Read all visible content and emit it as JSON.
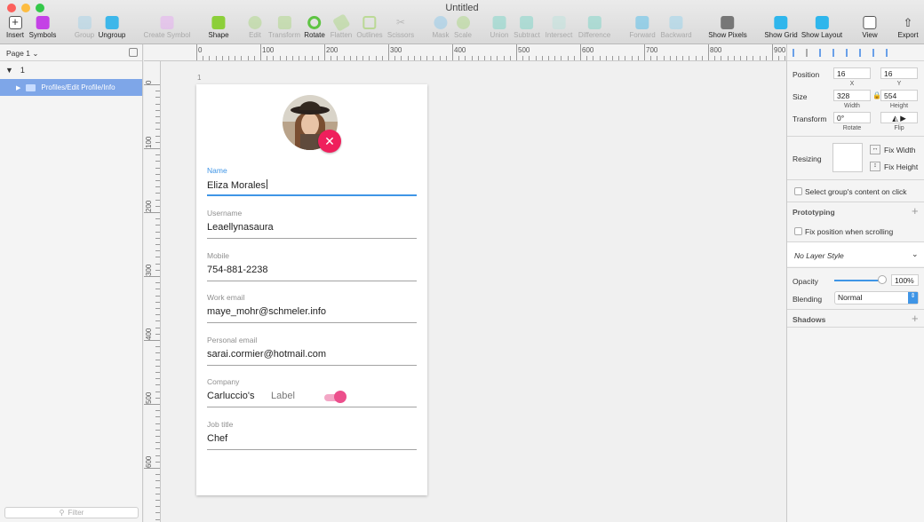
{
  "window": {
    "title": "Untitled",
    "traffic_lights": [
      "#fc605c",
      "#fdbc40",
      "#34c84a"
    ]
  },
  "toolbar": {
    "insert": "Insert",
    "symbols": "Symbols",
    "group": "Group",
    "ungroup": "Ungroup",
    "create_symbol": "Create Symbol",
    "shape": "Shape",
    "edit": "Edit",
    "transform": "Transform",
    "rotate": "Rotate",
    "flatten": "Flatten",
    "outlines": "Outlines",
    "scissors": "Scissors",
    "mask": "Mask",
    "scale": "Scale",
    "union": "Union",
    "subtract": "Subtract",
    "intersect": "Intersect",
    "difference": "Difference",
    "forward": "Forward",
    "backward": "Backward",
    "show_pixels": "Show Pixels",
    "show_grid": "Show Grid",
    "show_layout": "Show Layout",
    "view": "View",
    "export": "Export"
  },
  "layers": {
    "page_selector": "Page 1",
    "page_name": "1",
    "selected_layer": "Profiles/Edit Profile/Info",
    "filter_placeholder": "Filter"
  },
  "ruler": {
    "h_labels": [
      "0",
      "100",
      "200",
      "300",
      "400",
      "500",
      "600",
      "700",
      "800",
      "900"
    ],
    "v_labels": [
      "0",
      "100",
      "200",
      "300",
      "400",
      "500",
      "600"
    ]
  },
  "artboard": {
    "label": "1",
    "fields": [
      {
        "label": "Name",
        "value": "Eliza Morales"
      },
      {
        "label": "Username",
        "value": "Leaellynasaura"
      },
      {
        "label": "Mobile",
        "value": "754-881-2238"
      },
      {
        "label": "Work email",
        "value": "maye_mohr@schmeler.info"
      },
      {
        "label": "Personal email",
        "value": "sarai.cormier@hotmail.com"
      },
      {
        "label": "Company",
        "value": "Carluccio's",
        "extra_label": "Label"
      },
      {
        "label": "Job title",
        "value": "Chef"
      }
    ],
    "toggle_on": true,
    "accent": "#3f95e6",
    "danger": "#ef1f5c"
  },
  "inspector": {
    "position_label": "Position",
    "x": "16",
    "y": "16",
    "x_label": "X",
    "y_label": "Y",
    "size_label": "Size",
    "width": "328",
    "height": "554",
    "width_label": "Width",
    "height_label": "Height",
    "transform_label": "Transform",
    "rotate": "0°",
    "rotate_label": "Rotate",
    "flip_label": "Flip",
    "resizing_label": "Resizing",
    "fix_width": "Fix Width",
    "fix_height": "Fix Height",
    "select_group": "Select group's content on click",
    "prototyping": "Prototyping",
    "fix_position": "Fix position when scrolling",
    "layer_style": "No Layer Style",
    "opacity_label": "Opacity",
    "opacity": "100%",
    "blending_label": "Blending",
    "blending": "Normal",
    "shadows": "Shadows"
  }
}
